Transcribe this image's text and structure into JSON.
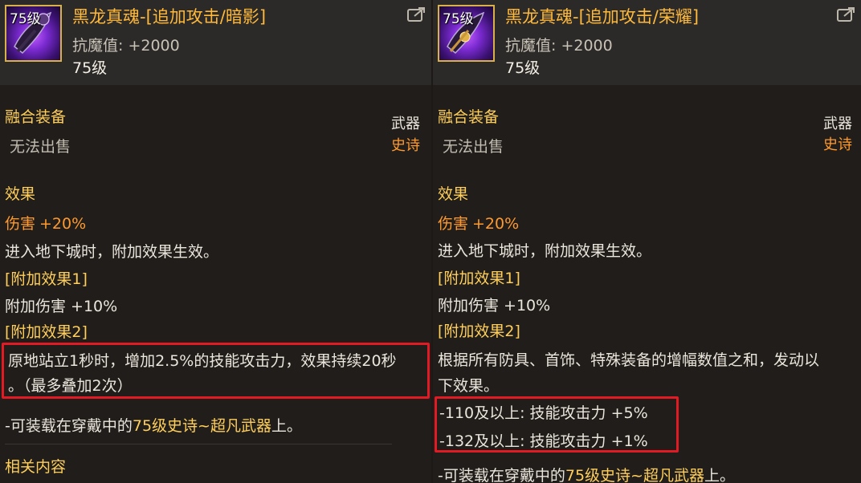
{
  "left": {
    "icon_level": "75级",
    "item_name": "黑龙真魂-[追加攻击/暗影]",
    "resist": "抗魔值: +2000",
    "level": "75级",
    "fusion_title": "融合装备",
    "no_sale": "无法出售",
    "slot": "武器",
    "rarity": "史诗",
    "effect_title": "效果",
    "damage_label": "伤害",
    "damage_value": "+20%",
    "dungeon_text": "进入地下城时，附加效果生效。",
    "extra1_title": "[附加效果1]",
    "extra1_text": "附加伤害 +10%",
    "extra2_title": "[附加效果2]",
    "extra2_line1": "原地站立1秒时，增加2.5%的技能攻击力，效果持续20秒",
    "extra2_line2": "。（最多叠加2次）",
    "equip_prefix": "-可装载在穿戴中的",
    "equip_highlight": "75级史诗~超凡武器",
    "equip_suffix": "上。",
    "related": "相关内容"
  },
  "right": {
    "icon_level": "75级",
    "item_name": "黑龙真魂-[追加攻击/荣耀]",
    "resist": "抗魔值: +2000",
    "level": "75级",
    "fusion_title": "融合装备",
    "no_sale": "无法出售",
    "slot": "武器",
    "rarity": "史诗",
    "effect_title": "效果",
    "damage_label": "伤害",
    "damage_value": "+20%",
    "dungeon_text": "进入地下城时，附加效果生效。",
    "extra1_title": "[附加效果1]",
    "extra1_text": "附加伤害 +10%",
    "extra2_title": "[附加效果2]",
    "extra2_line1": "根据所有防具、首饰、特殊装备的增幅数值之和，发动以",
    "extra2_line2": "下效果。",
    "tier1": "-110及以上: 技能攻击力 +5%",
    "tier2": "-132及以上: 技能攻击力 +1%",
    "equip_prefix": "-可装载在穿戴中的",
    "equip_highlight": "75级史诗~超凡武器",
    "equip_suffix": "上。"
  },
  "colors": {
    "gold": "#ffcf5a",
    "orange": "#ff9a2e",
    "highlight_box": "#e21a24",
    "item_name": "#ffb93a"
  },
  "icons": [
    "weapon-icon-shadow",
    "weapon-icon-glory",
    "share-icon"
  ]
}
